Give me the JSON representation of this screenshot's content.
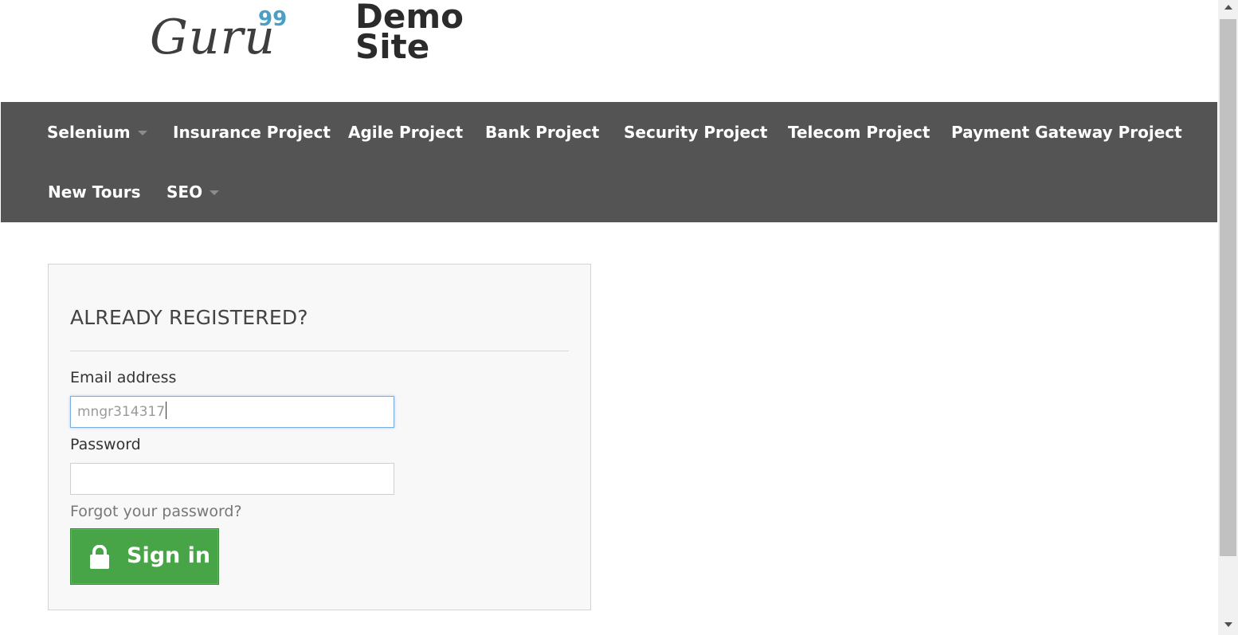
{
  "header": {
    "logo_text": "Guru",
    "logo_superscript": "99",
    "site_title_line1": "Demo",
    "site_title_line2": "Site"
  },
  "nav": {
    "items": [
      {
        "label": "Selenium",
        "dropdown": true
      },
      {
        "label": "Insurance Project",
        "dropdown": false
      },
      {
        "label": "Agile Project",
        "dropdown": false
      },
      {
        "label": "Bank Project",
        "dropdown": false
      },
      {
        "label": "Security Project",
        "dropdown": false
      },
      {
        "label": "Telecom Project",
        "dropdown": false
      },
      {
        "label": "Payment Gateway Project",
        "dropdown": false
      },
      {
        "label": "New Tours",
        "dropdown": false
      },
      {
        "label": "SEO",
        "dropdown": true
      }
    ],
    "background_color": "#545454"
  },
  "login": {
    "title": "ALREADY REGISTERED?",
    "email_label": "Email address",
    "email_value": "mngr314317",
    "password_label": "Password",
    "password_value": "",
    "forgot_link": "Forgot your password?",
    "signin_label": "Sign in",
    "signin_icon": "lock-icon",
    "button_color": "#47a447"
  }
}
